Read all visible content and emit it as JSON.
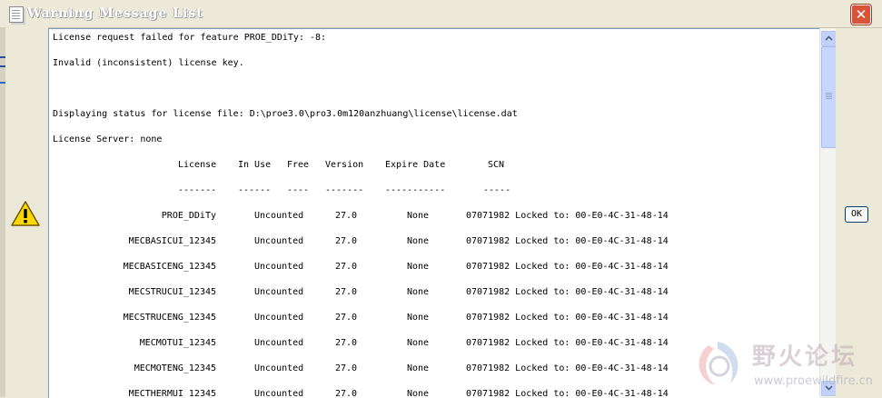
{
  "window": {
    "title": "Warning Message List",
    "close_glyph": "✕"
  },
  "messages": {
    "header_lines": [
      "License request failed for feature PROE_DDiTy: -8:",
      "Invalid (inconsistent) license key.",
      "",
      "Displaying status for license file: D:\\proe3.0\\pro3.0m120anzhuang\\license\\license.dat",
      "License Server: none"
    ],
    "columns": [
      "License",
      "In Use",
      "Free",
      "Version",
      "Expire Date",
      "SCN"
    ],
    "separators": [
      "-------",
      "------",
      "----",
      "-------",
      "-----------",
      "-----"
    ],
    "rows": [
      {
        "license": "PROE_DDiTy",
        "in_use": "Uncounted",
        "version": "27.0",
        "expire": "None",
        "scn": "07071982 Locked to: 00-E0-4C-31-48-14"
      },
      {
        "license": "MECBASICUI_12345",
        "in_use": "Uncounted",
        "version": "27.0",
        "expire": "None",
        "scn": "07071982 Locked to: 00-E0-4C-31-48-14"
      },
      {
        "license": "MECBASICENG_12345",
        "in_use": "Uncounted",
        "version": "27.0",
        "expire": "None",
        "scn": "07071982 Locked to: 00-E0-4C-31-48-14"
      },
      {
        "license": "MECSTRUCUI_12345",
        "in_use": "Uncounted",
        "version": "27.0",
        "expire": "None",
        "scn": "07071982 Locked to: 00-E0-4C-31-48-14"
      },
      {
        "license": "MECSTRUCENG_12345",
        "in_use": "Uncounted",
        "version": "27.0",
        "expire": "None",
        "scn": "07071982 Locked to: 00-E0-4C-31-48-14"
      },
      {
        "license": "MECMOTUI_12345",
        "in_use": "Uncounted",
        "version": "27.0",
        "expire": "None",
        "scn": "07071982 Locked to: 00-E0-4C-31-48-14"
      },
      {
        "license": "MECMOTENG_12345",
        "in_use": "Uncounted",
        "version": "27.0",
        "expire": "None",
        "scn": "07071982 Locked to: 00-E0-4C-31-48-14"
      },
      {
        "license": "MECTHERMUI_12345",
        "in_use": "Uncounted",
        "version": "27.0",
        "expire": "None",
        "scn": "07071982 Locked to: 00-E0-4C-31-48-14"
      }
    ]
  },
  "buttons": {
    "ok_label": "OK"
  },
  "watermark": {
    "text": "野火论坛",
    "url": "www.proewildfire.cn"
  },
  "icons": {
    "title": "document-icon",
    "warning": "warning-icon",
    "scroll_up": "arrow-up-icon",
    "scroll_down": "arrow-down-icon"
  },
  "colors": {
    "title_bg": "#ece9d8",
    "close_button": "#d9533b",
    "text": "#000000",
    "scrollbar": "#c6d6fc"
  }
}
